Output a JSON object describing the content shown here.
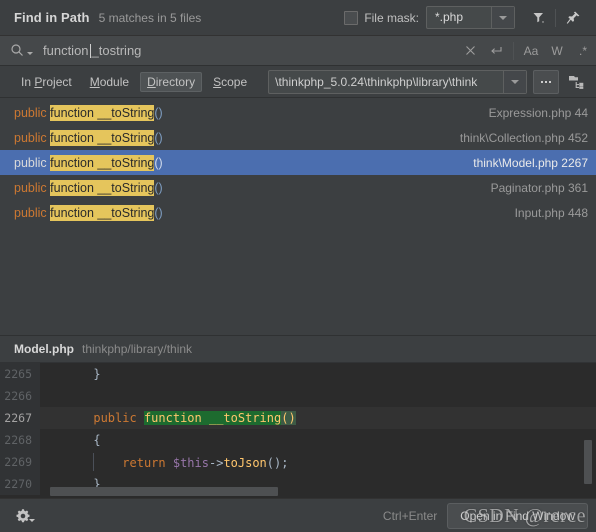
{
  "window": {
    "title": "Find in Path",
    "summary": "5 matches in 5 files"
  },
  "toolbar": {
    "file_mask_label": "File mask:",
    "file_mask_value": "*.php",
    "filter_icon": "filter-funnel-icon",
    "pin_icon": "pin-icon",
    "checkbox_checked": false
  },
  "search": {
    "icon": "search-icon",
    "value_before_caret": "function ",
    "value_after_caret": "_tostring",
    "full_value": "function __tostring",
    "clear_icon": "close-icon",
    "history_icon": "return-arrow-icon",
    "match_case_label": "Aa",
    "words_label": "W",
    "regex_label": ".*"
  },
  "scope": {
    "tabs": [
      {
        "label": "In Project",
        "underline": "P",
        "active": false
      },
      {
        "label": "Module",
        "underline": "M",
        "active": false
      },
      {
        "label": "Directory",
        "underline": "D",
        "active": true
      },
      {
        "label": "Scope",
        "underline": "S",
        "active": false
      }
    ],
    "directory_path": "\\thinkphp_5.0.24\\thinkphp\\library\\think",
    "browse_label": "...",
    "tree_icon": "project-tree-icon"
  },
  "results": [
    {
      "prefix": "public ",
      "match_kw": "function",
      "match_gap": " ",
      "match_name": "__toString",
      "suffix": "()",
      "file": "Expression.php",
      "line": "44",
      "file_ref": "Expression.php 44",
      "selected": false
    },
    {
      "prefix": "public ",
      "match_kw": "function",
      "match_gap": " ",
      "match_name": "__toString",
      "suffix": "()",
      "file": "think\\Collection.php",
      "line": "452",
      "file_ref": "think\\Collection.php 452",
      "selected": false
    },
    {
      "prefix": "public ",
      "match_kw": "function",
      "match_gap": " ",
      "match_name": "__toString",
      "suffix": "()",
      "file": "think\\Model.php",
      "line": "2267",
      "file_ref": "think\\Model.php 2267",
      "selected": true
    },
    {
      "prefix": "public ",
      "match_kw": "function",
      "match_gap": " ",
      "match_name": "__toString",
      "suffix": "()",
      "file": "Paginator.php",
      "line": "361",
      "file_ref": "Paginator.php 361",
      "selected": false
    },
    {
      "prefix": "public ",
      "match_kw": "function",
      "match_gap": " ",
      "match_name": "__toString",
      "suffix": "()",
      "file": "Input.php",
      "line": "448",
      "file_ref": "Input.php 448",
      "selected": false
    }
  ],
  "preview": {
    "file_name": "Model.php",
    "file_path": "thinkphp/library/think",
    "lines": [
      {
        "num": "2265",
        "text": "    }",
        "current": false
      },
      {
        "num": "2266",
        "text": "",
        "current": false
      },
      {
        "num": "2267",
        "text": "    public function __toString()",
        "current": true
      },
      {
        "num": "2268",
        "text": "    {",
        "current": false
      },
      {
        "num": "2269",
        "text": "        return $this->toJson();",
        "current": false
      },
      {
        "num": "2270",
        "text": "    }",
        "current": false
      }
    ],
    "code_2267": {
      "kw_public": "public",
      "kw_function": "function",
      "fn_name": "__toString",
      "parens": "()"
    },
    "code_2269": {
      "kw_return": "return",
      "var_this": "$this",
      "arrow": "->",
      "call": "toJson",
      "tail": "();"
    }
  },
  "footer": {
    "settings_icon": "gear-icon",
    "shortcut": "Ctrl+Enter",
    "open_button": "Open in Find Window",
    "watermark": "CSDN @rerce"
  },
  "colors": {
    "accent_selection": "#4b6eaf",
    "match_highlight": "#e5c55c",
    "keyword": "#cc7832",
    "function_name": "#ffc66d",
    "editor_bg": "#2b2b2b",
    "panel_bg": "#3c3f41"
  }
}
